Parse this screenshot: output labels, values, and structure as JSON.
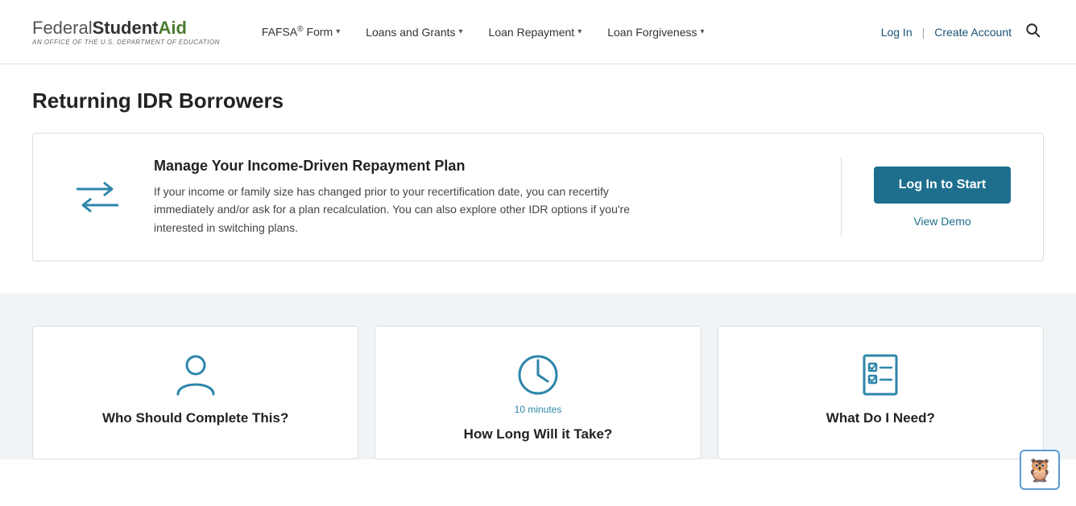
{
  "logo": {
    "federal": "Federal",
    "student": "Student",
    "aid": "Aid",
    "subtitle": "An Office of the U.S. Department of Education"
  },
  "nav": {
    "fafsa_label": "FAFSA",
    "fafsa_reg": "®",
    "fafsa_suffix": " Form",
    "loans_grants": "Loans and Grants",
    "loan_repayment": "Loan Repayment",
    "loan_forgiveness": "Loan Forgiveness"
  },
  "header_actions": {
    "login": "Log In",
    "divider": "|",
    "create_account": "Create Account"
  },
  "page": {
    "title": "Returning IDR Borrowers"
  },
  "idr_card": {
    "title": "Manage Your Income-Driven Repayment Plan",
    "description": "If your income or family size has changed prior to your recertification date, you can recertify immediately and/or ask for a plan recalculation. You can also explore other IDR options if you're interested in switching plans.",
    "login_button": "Log In to Start",
    "view_demo": "View Demo"
  },
  "info_cards": [
    {
      "icon_name": "person-icon",
      "title": "Who Should Complete This?"
    },
    {
      "icon_name": "clock-icon",
      "subtitle": "10 minutes",
      "title": "How Long Will it Take?"
    },
    {
      "icon_name": "checklist-icon",
      "title": "What Do I Need?"
    }
  ]
}
